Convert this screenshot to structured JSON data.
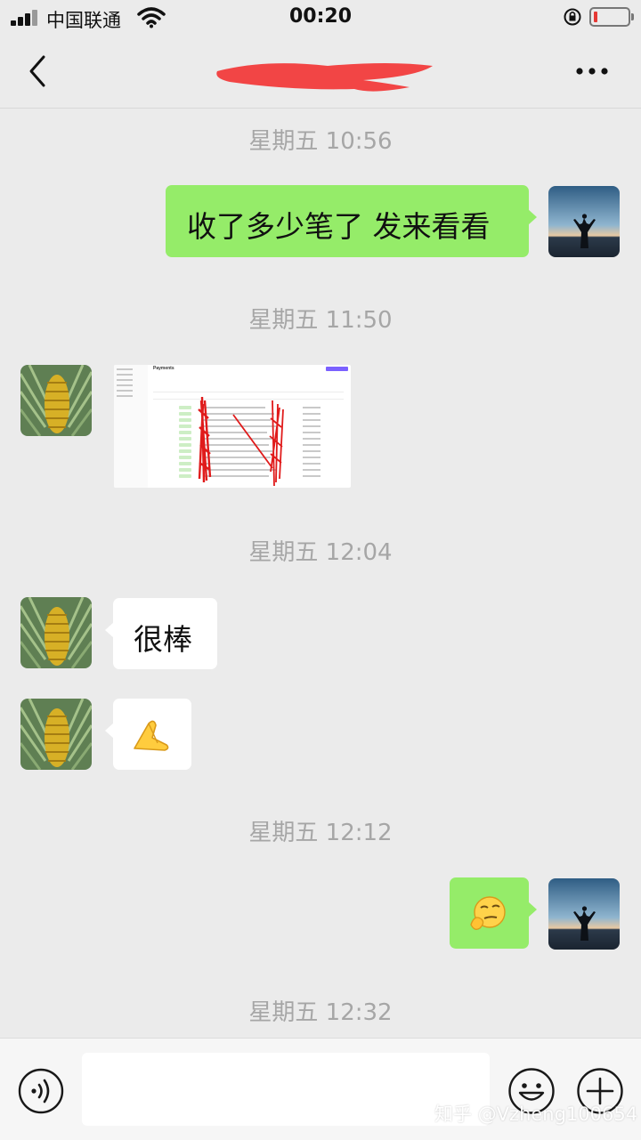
{
  "status_bar": {
    "carrier": "中国联通",
    "time": "00:20",
    "battery_level": 0.1,
    "battery_color": "#e53935"
  },
  "nav": {
    "title_redaction_color": "#f24545"
  },
  "messages": [
    {
      "type": "timestamp",
      "text": "星期五 10:56"
    },
    {
      "type": "text",
      "side": "right",
      "text": "收了多少笔了 发来看看"
    },
    {
      "type": "timestamp",
      "text": "星期五 11:50"
    },
    {
      "type": "image",
      "side": "left",
      "image_title": "Payments"
    },
    {
      "type": "timestamp",
      "text": "星期五 12:04"
    },
    {
      "type": "text",
      "side": "left",
      "text": "很棒"
    },
    {
      "type": "emoji",
      "side": "left",
      "emoji": "🙏"
    },
    {
      "type": "timestamp",
      "text": "星期五 12:12"
    },
    {
      "type": "emoji",
      "side": "right",
      "emoji": "smirk-face-emoji"
    },
    {
      "type": "timestamp",
      "text": "星期五 12:32"
    }
  ],
  "input_bar": {
    "watermark": "知乎 @Vzheng100654"
  },
  "colors": {
    "background": "#ebebeb",
    "bubble_sent": "#95ec69",
    "bubble_received": "#ffffff",
    "timestamp_text": "#a6a6a6"
  }
}
